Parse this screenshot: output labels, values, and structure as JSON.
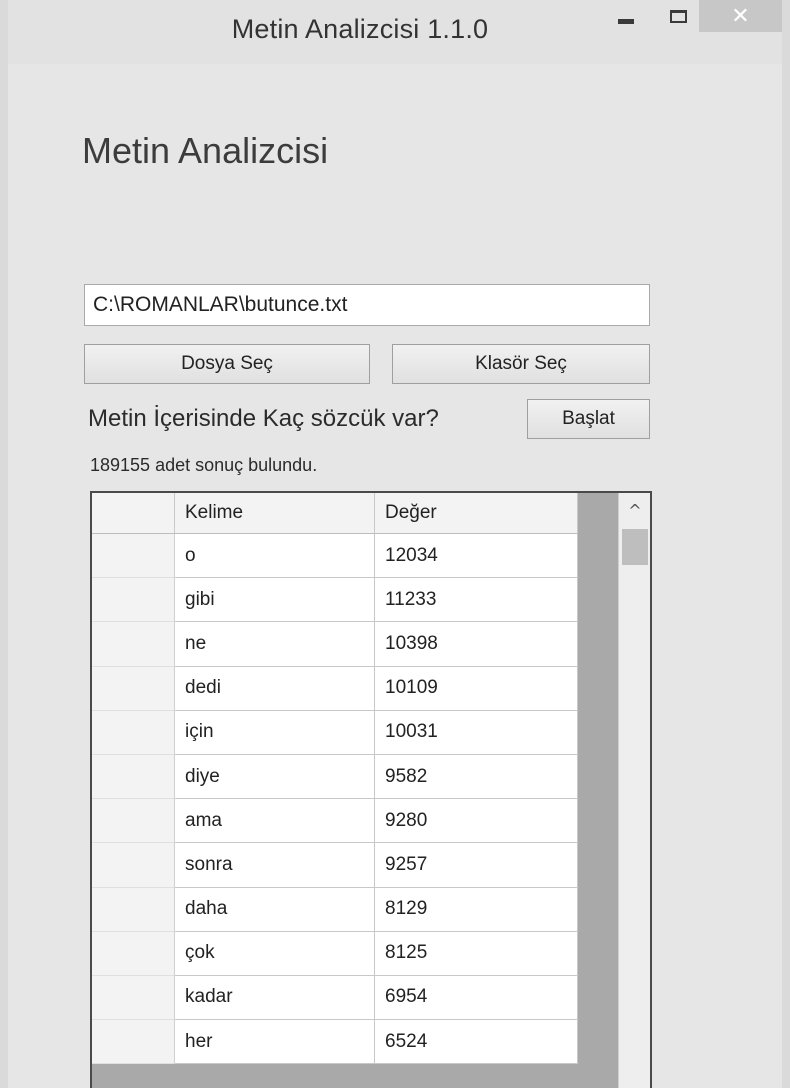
{
  "window": {
    "title": "Metin Analizcisi 1.1.0",
    "close_glyph": "✕"
  },
  "form": {
    "heading": "Metin Analizcisi",
    "path_value": "C:\\ROMANLAR\\butunce.txt",
    "select_file_label": "Dosya Seç",
    "select_folder_label": "Klasör Seç",
    "question": "Metin İçerisinde Kaç sözcük var?",
    "start_label": "Başlat",
    "result_text": "189155 adet sonuç bulundu."
  },
  "grid": {
    "columns": [
      "Kelime",
      "Değer"
    ],
    "rows": [
      {
        "word": "o",
        "value": "12034"
      },
      {
        "word": "gibi",
        "value": "11233"
      },
      {
        "word": "ne",
        "value": "10398"
      },
      {
        "word": "dedi",
        "value": "10109"
      },
      {
        "word": "için",
        "value": "10031"
      },
      {
        "word": "diye",
        "value": "9582"
      },
      {
        "word": "ama",
        "value": "9280"
      },
      {
        "word": "sonra",
        "value": "9257"
      },
      {
        "word": "daha",
        "value": "8129"
      },
      {
        "word": "çok",
        "value": "8125"
      },
      {
        "word": "kadar",
        "value": "6954"
      },
      {
        "word": "her",
        "value": "6524"
      }
    ],
    "scroll_up_glyph": "^"
  },
  "colors": {
    "window_bg": "#e6e6e6",
    "grid_bg": "#a9a9a9",
    "close_bg": "#c7c7c7"
  }
}
